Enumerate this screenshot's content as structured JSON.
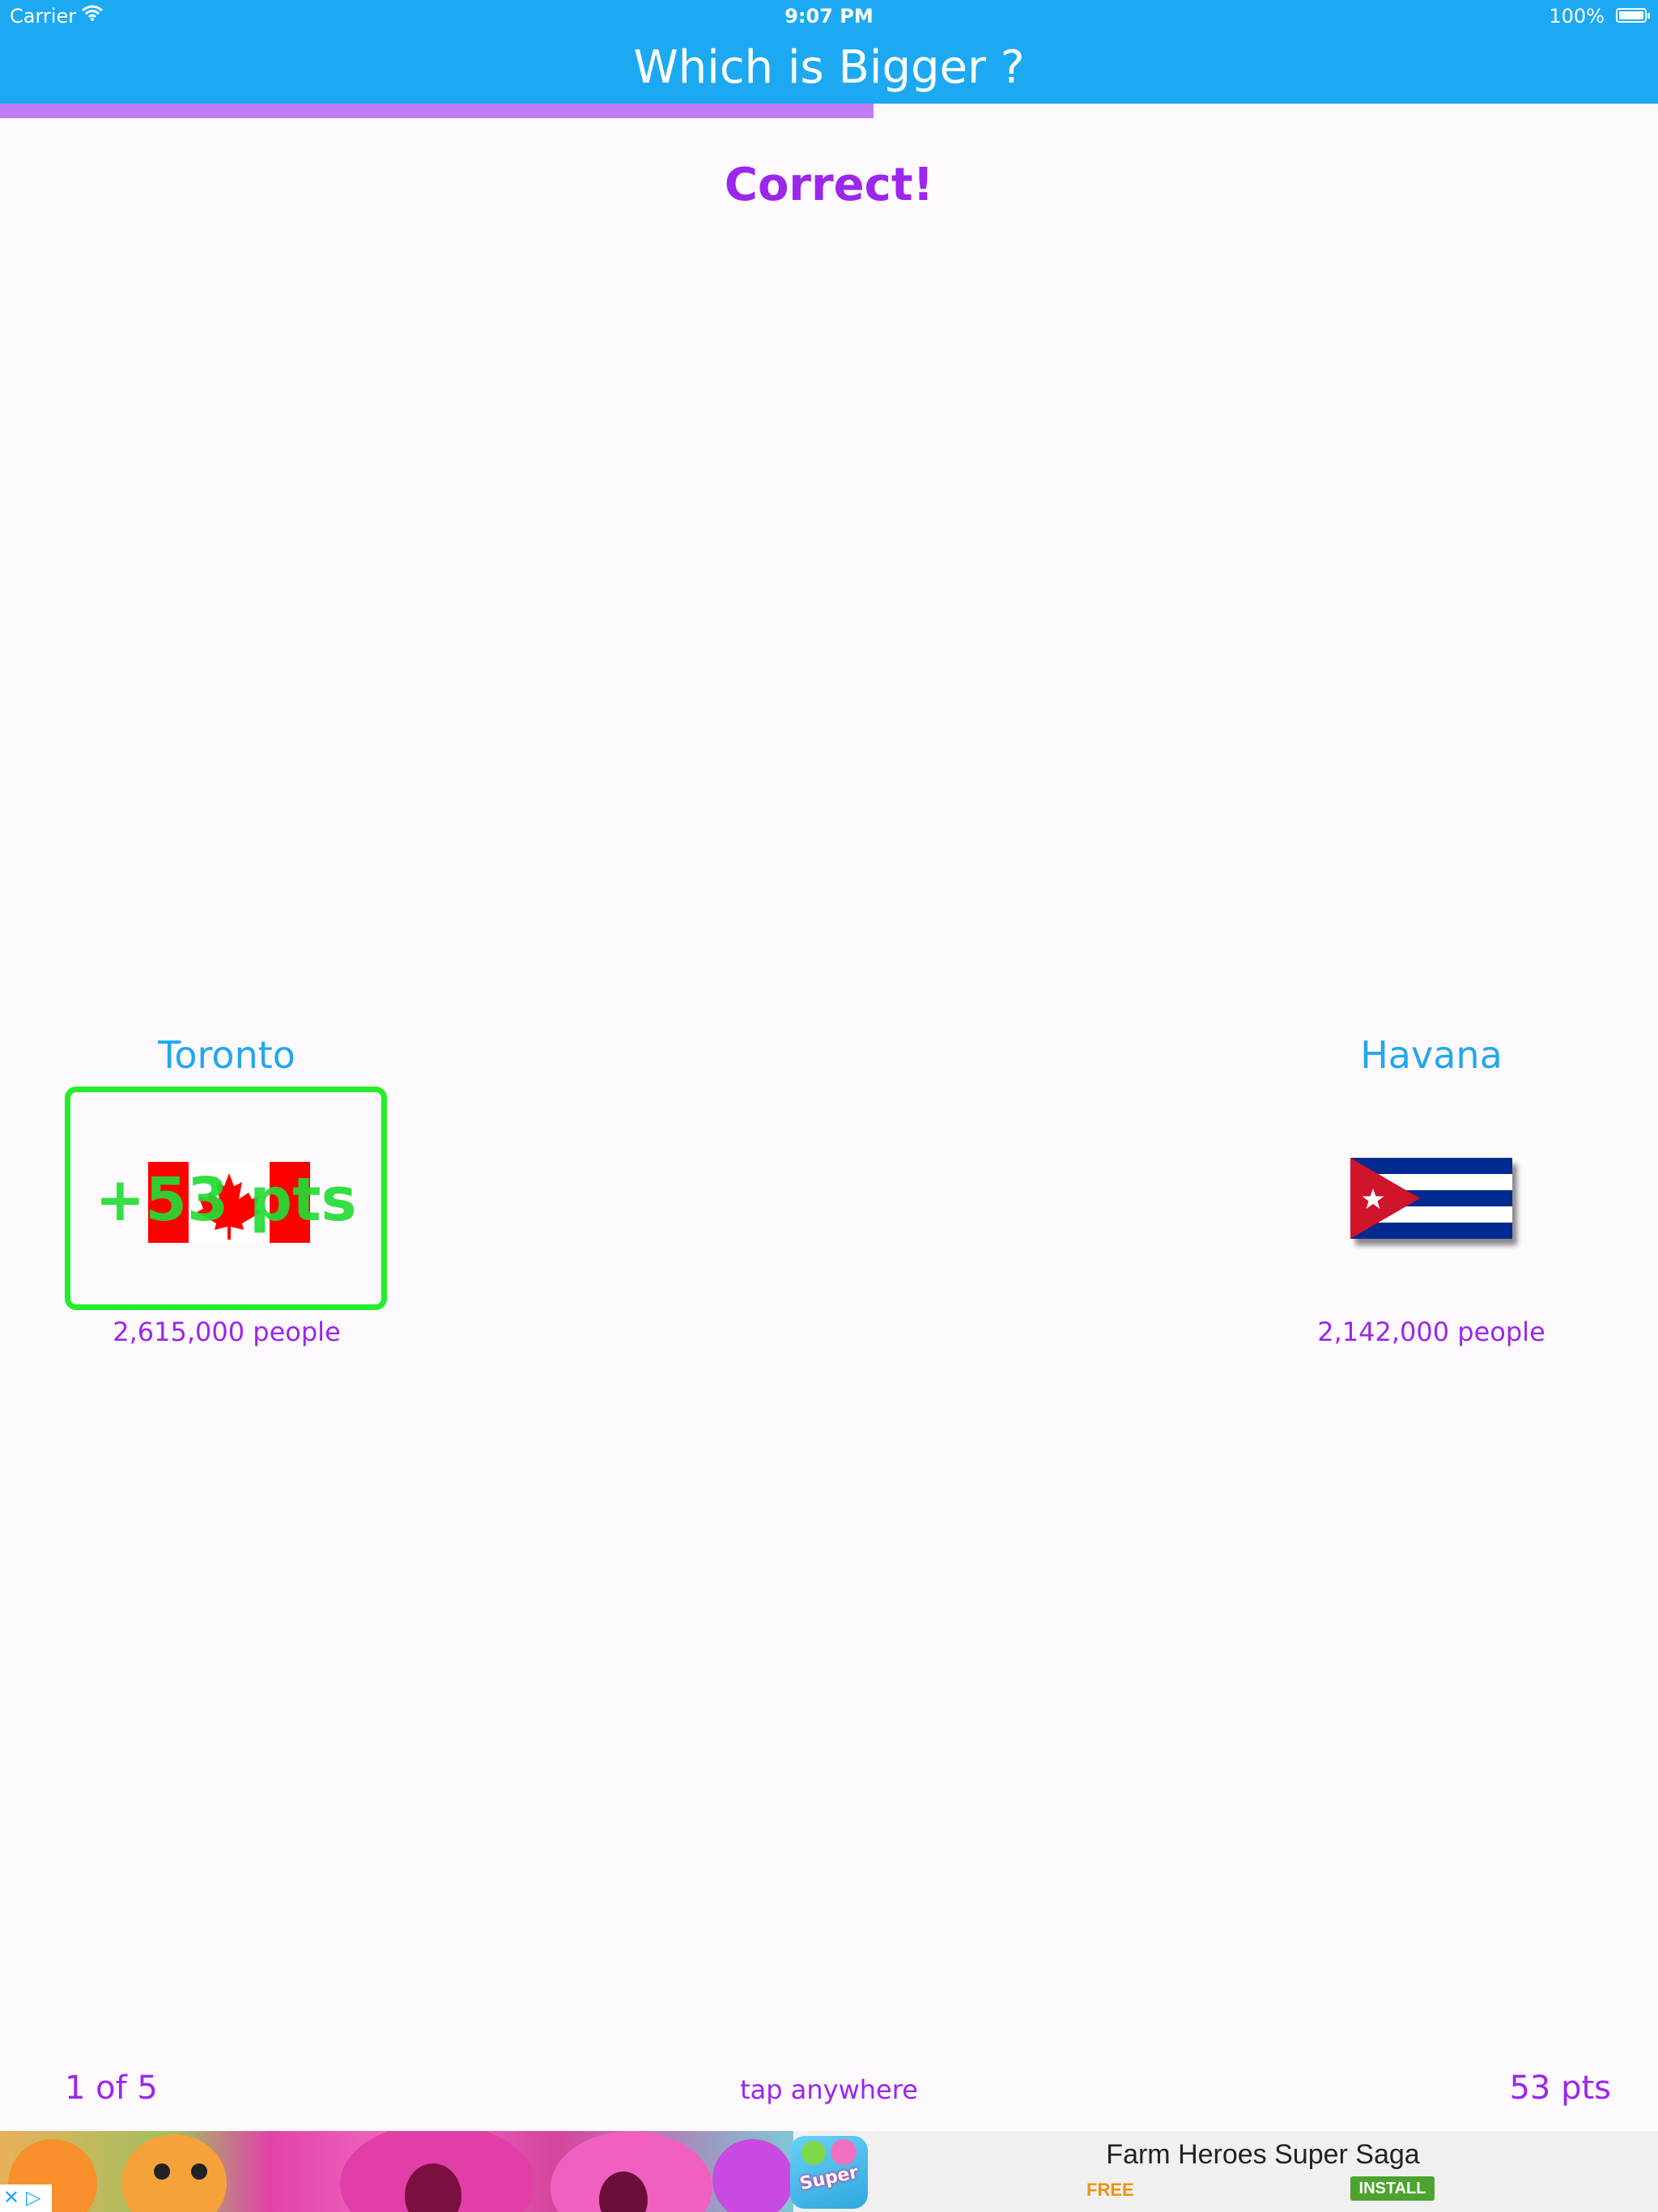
{
  "status_bar": {
    "carrier": "Carrier",
    "time": "9:07 PM",
    "battery": "100%"
  },
  "header": {
    "title": "Which is Bigger ?"
  },
  "progress": {
    "fraction": 0.527,
    "color": "#c07cf3"
  },
  "result": {
    "text": "Correct!"
  },
  "left_choice": {
    "city": "Toronto",
    "points_awarded": "+53 pts",
    "population": "2,615,000 people",
    "flag_icon": "canada-flag"
  },
  "right_choice": {
    "city": "Havana",
    "population": "2,142,000 people",
    "flag_icon": "cuba-flag"
  },
  "footer": {
    "counter": "1 of 5",
    "hint": "tap anywhere",
    "score": "53 pts"
  },
  "ad": {
    "app_name": "Farm Heroes Super Saga",
    "price": "FREE",
    "install_label": "INSTALL",
    "icon_word": "Super"
  },
  "colors": {
    "header_blue": "#1da9f2",
    "accent_purple": "#9b26ec",
    "city_blue": "#22a7ee",
    "correct_green": "#22ee2a"
  }
}
